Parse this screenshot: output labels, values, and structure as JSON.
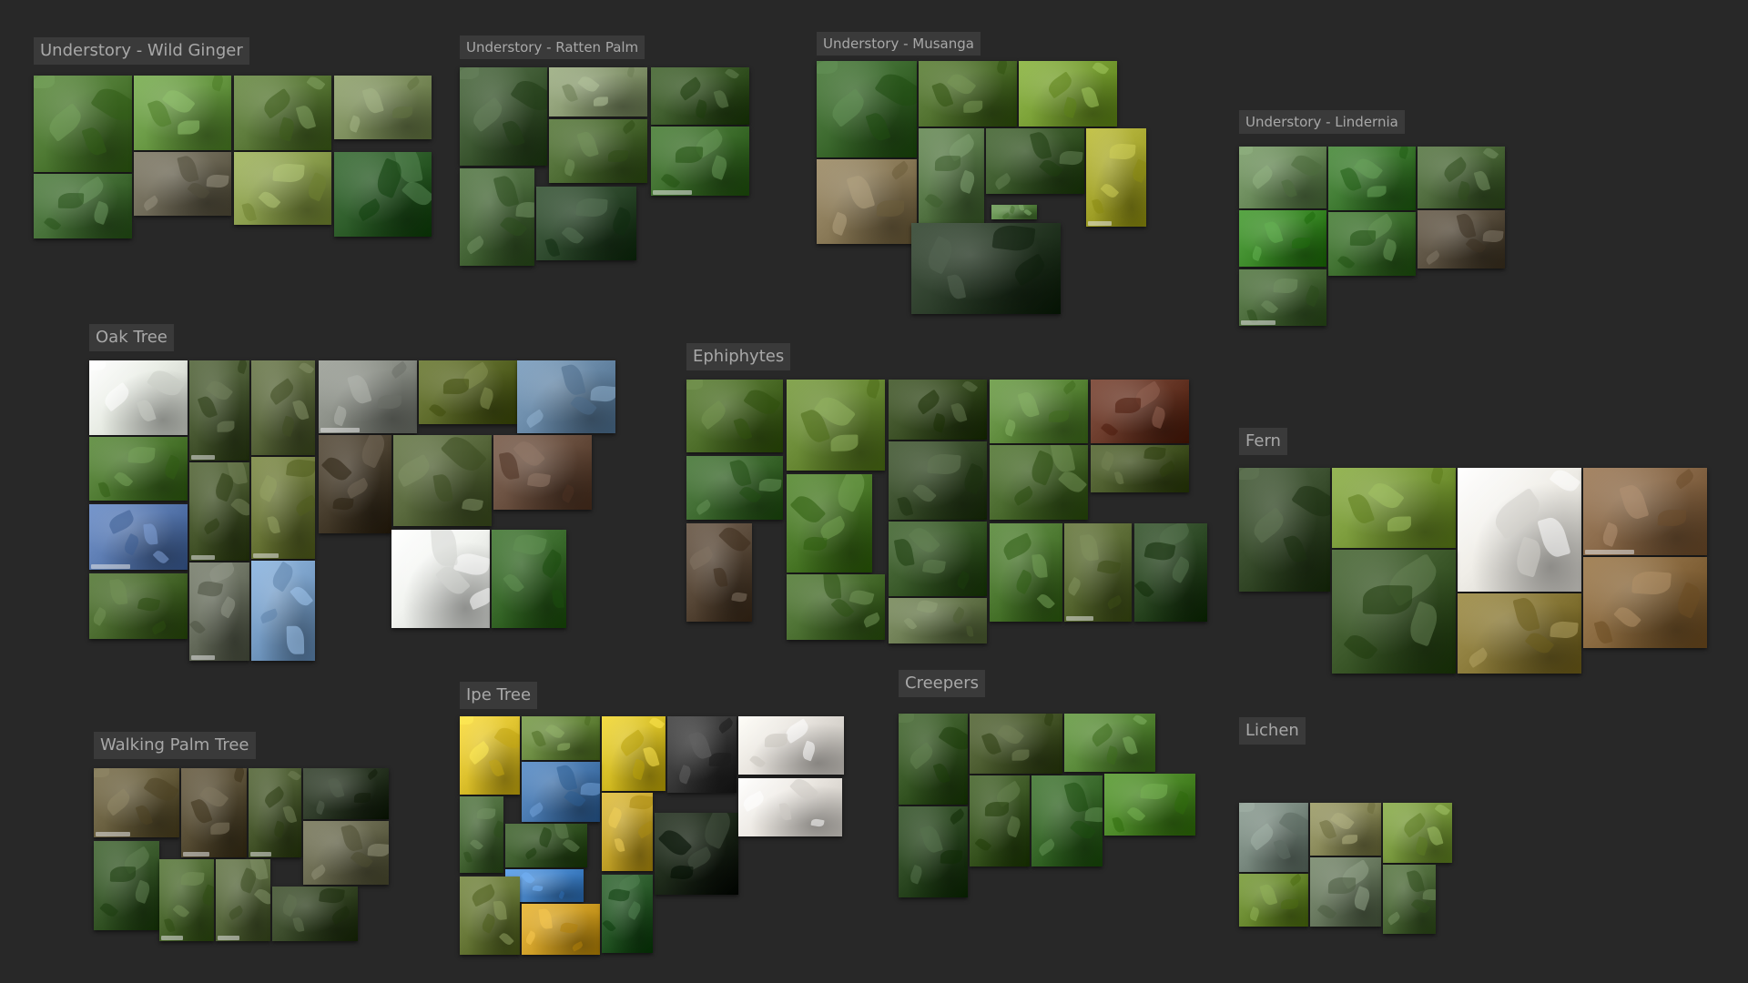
{
  "board": {
    "background": "#282828",
    "label_bg": "#3a3a3a",
    "label_color": "#a8a8a8"
  },
  "groups": [
    {
      "id": "wild-ginger",
      "label": "Understory - Wild Ginger",
      "tile_colors": [
        "#4f7a34",
        "#6a9a45",
        "#5c7a3a",
        "#7e8f5e",
        "#467038",
        "#6f6a58",
        "#8da050",
        "#2f5e2b"
      ]
    },
    {
      "id": "ratten-palm",
      "label": "Understory - Ratten Palm",
      "tile_colors": [
        "#3f5a34",
        "#8a9a72",
        "#3c5a2a",
        "#4d6b33",
        "#40702f",
        "#4a6a3c",
        "#2f4a2e"
      ]
    },
    {
      "id": "musanga",
      "label": "Understory - Musanga",
      "tile_colors": [
        "#3d6a2f",
        "#50702e",
        "#7aa036",
        "#8a7a58",
        "#5a7a4a",
        "#3c5a2c",
        "#a8a830",
        "#5f8a4a",
        "#2c3d2a"
      ]
    },
    {
      "id": "lindernia",
      "label": "Understory - Lindernia",
      "tile_colors": [
        "#6a8a5a",
        "#3f7a32",
        "#4e6a3c",
        "#3d8a2a",
        "#3f7030",
        "#5a5040",
        "#4a6a3a"
      ]
    },
    {
      "id": "oak-tree",
      "label": "Oak Tree",
      "tile_colors": [
        "#e8ece4",
        "#4a5a34",
        "#5d6a40",
        "#8a8e86",
        "#5d6a2a",
        "#6a8aa8",
        "#4f7a32",
        "#4a5a30",
        "#6e7a3c",
        "#4a4030",
        "#5a6a3e",
        "#6a5040",
        "#5a7ab0",
        "#4a6a2e",
        "#6a7060",
        "#f2f4f0",
        "#3a6a2c",
        "#7aa0c8",
        "#5a6e34",
        "#4a4a36"
      ]
    },
    {
      "id": "ephiphytes",
      "label": "Ephiphytes",
      "tile_colors": [
        "#4e6e2a",
        "#6a8a36",
        "#3a4e24",
        "#5e8a3c",
        "#6a3a2a",
        "#3e6a30",
        "#3a4e2c",
        "#4a6a2e",
        "#4a5a2a",
        "#4c7a2a",
        "#5a4a3a",
        "#3a5a2a",
        "#4e7a32",
        "#5a6a34",
        "#2e4a26",
        "#4a6e30",
        "#6a7a50",
        "#4e6a30"
      ]
    },
    {
      "id": "fern",
      "label": "Fern",
      "tile_colors": [
        "#3a4e2e",
        "#7a9a3a",
        "#f0eee8",
        "#8a6a4a",
        "#3e5a2c",
        "#8a7a3a",
        "#8a6a40"
      ]
    },
    {
      "id": "walking-palm",
      "label": "Walking Palm Tree",
      "tile_colors": [
        "#6a6040",
        "#5a5038",
        "#4a5a30",
        "#2e3a28",
        "#3a5a2c",
        "#6a6a50",
        "#4e6a32",
        "#5a6a40",
        "#3a4a2a"
      ]
    },
    {
      "id": "ipe-tree",
      "label": "Ipe Tree",
      "tile_colors": [
        "#e0c430",
        "#6a8a40",
        "#d8c028",
        "#3a3a3a",
        "#e6e2dc",
        "#4a7ab0",
        "#4a6a3a",
        "#3a5a2a",
        "#c8a830",
        "#1e2a1a",
        "#ece8e2",
        "#4a8acf",
        "#6a7a3a",
        "#d0a028",
        "#2a5a2a",
        "#4a6a90"
      ]
    },
    {
      "id": "creepers",
      "label": "Creepers",
      "tile_colors": [
        "#3a5a28",
        "#4a5a2e",
        "#5a8a3a",
        "#2e4a24",
        "#3e5a26",
        "#3a6a2c",
        "#4e8a2a"
      ]
    },
    {
      "id": "lichen",
      "label": "Lichen",
      "tile_colors": [
        "#7a8a80",
        "#8a8a5a",
        "#7a9a40",
        "#6a8a30",
        "#6a7a60",
        "#4e6a3a"
      ]
    }
  ]
}
